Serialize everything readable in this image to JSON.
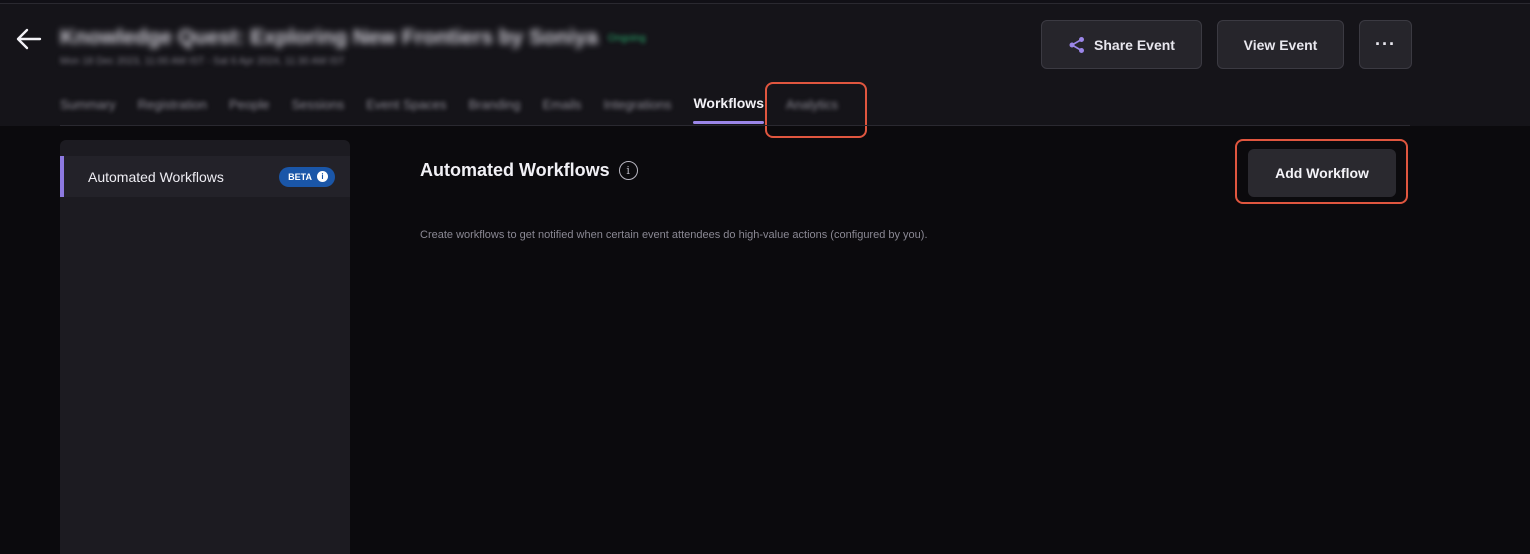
{
  "header": {
    "event_title": "Knowledge Quest: Exploring New Frontiers by Soniya",
    "status": "Ongoing",
    "event_dates": "Mon 18 Dec 2023, 11:00 AM IST - Sat 6 Apr 2024, 11:30 AM IST",
    "share_label": "Share Event",
    "view_label": "View Event",
    "more_label": "···"
  },
  "tabs": [
    {
      "label": "Summary"
    },
    {
      "label": "Registration"
    },
    {
      "label": "People"
    },
    {
      "label": "Sessions"
    },
    {
      "label": "Event Spaces"
    },
    {
      "label": "Branding"
    },
    {
      "label": "Emails"
    },
    {
      "label": "Integrations"
    },
    {
      "label": "Workflows",
      "active": true
    },
    {
      "label": "Analytics"
    }
  ],
  "sidebar": {
    "items": [
      {
        "label": "Automated Workflows",
        "badge": "BETA",
        "active": true
      }
    ]
  },
  "main": {
    "title": "Automated Workflows",
    "description": "Create workflows to get notified when certain event attendees do high-value actions (configured by you).",
    "add_button_label": "Add Workflow"
  },
  "colors": {
    "accent": "#9b86e8",
    "highlight": "#e0563f",
    "beta_badge": "#1a56a8",
    "background": "#0b0a0d"
  },
  "icons": {
    "back": "arrow-left-icon",
    "share": "share-icon",
    "info": "info-icon"
  }
}
